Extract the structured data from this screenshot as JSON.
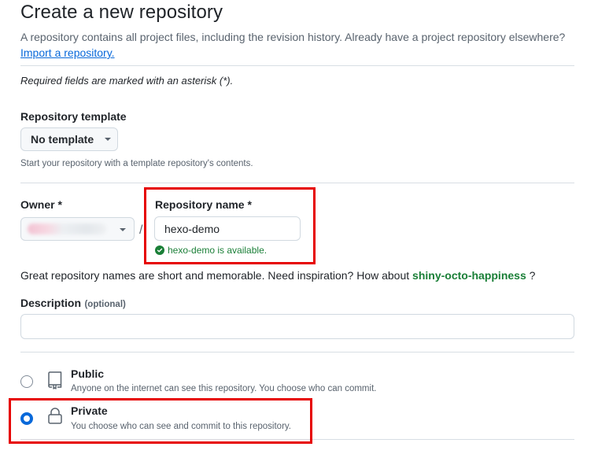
{
  "header": {
    "title": "Create a new repository",
    "subtitle": "A repository contains all project files, including the revision history. Already have a project repository elsewhere?",
    "import_link": "Import a repository."
  },
  "required_note": "Required fields are marked with an asterisk (*).",
  "template": {
    "label": "Repository template",
    "button_label": "No template",
    "hint": "Start your repository with a template repository's contents."
  },
  "owner": {
    "label": "Owner *"
  },
  "slash": "/",
  "repo_name": {
    "label": "Repository name *",
    "value": "hexo-demo",
    "availability": "hexo-demo is available."
  },
  "inspiration": {
    "text": "Great repository names are short and memorable. Need inspiration? How about",
    "suggestion": "shiny-octo-happiness",
    "suffix": "?"
  },
  "description": {
    "label": "Description",
    "optional": "(optional)",
    "value": ""
  },
  "visibility": {
    "options": [
      {
        "title": "Public",
        "description": "Anyone on the internet can see this repository. You choose who can commit.",
        "selected": false,
        "icon": "repo-icon"
      },
      {
        "title": "Private",
        "description": "You choose who can see and commit to this repository.",
        "selected": true,
        "icon": "lock-icon"
      }
    ]
  },
  "colors": {
    "accent": "#0969da",
    "success": "#1a7f37",
    "highlight_box": "#e60000"
  }
}
